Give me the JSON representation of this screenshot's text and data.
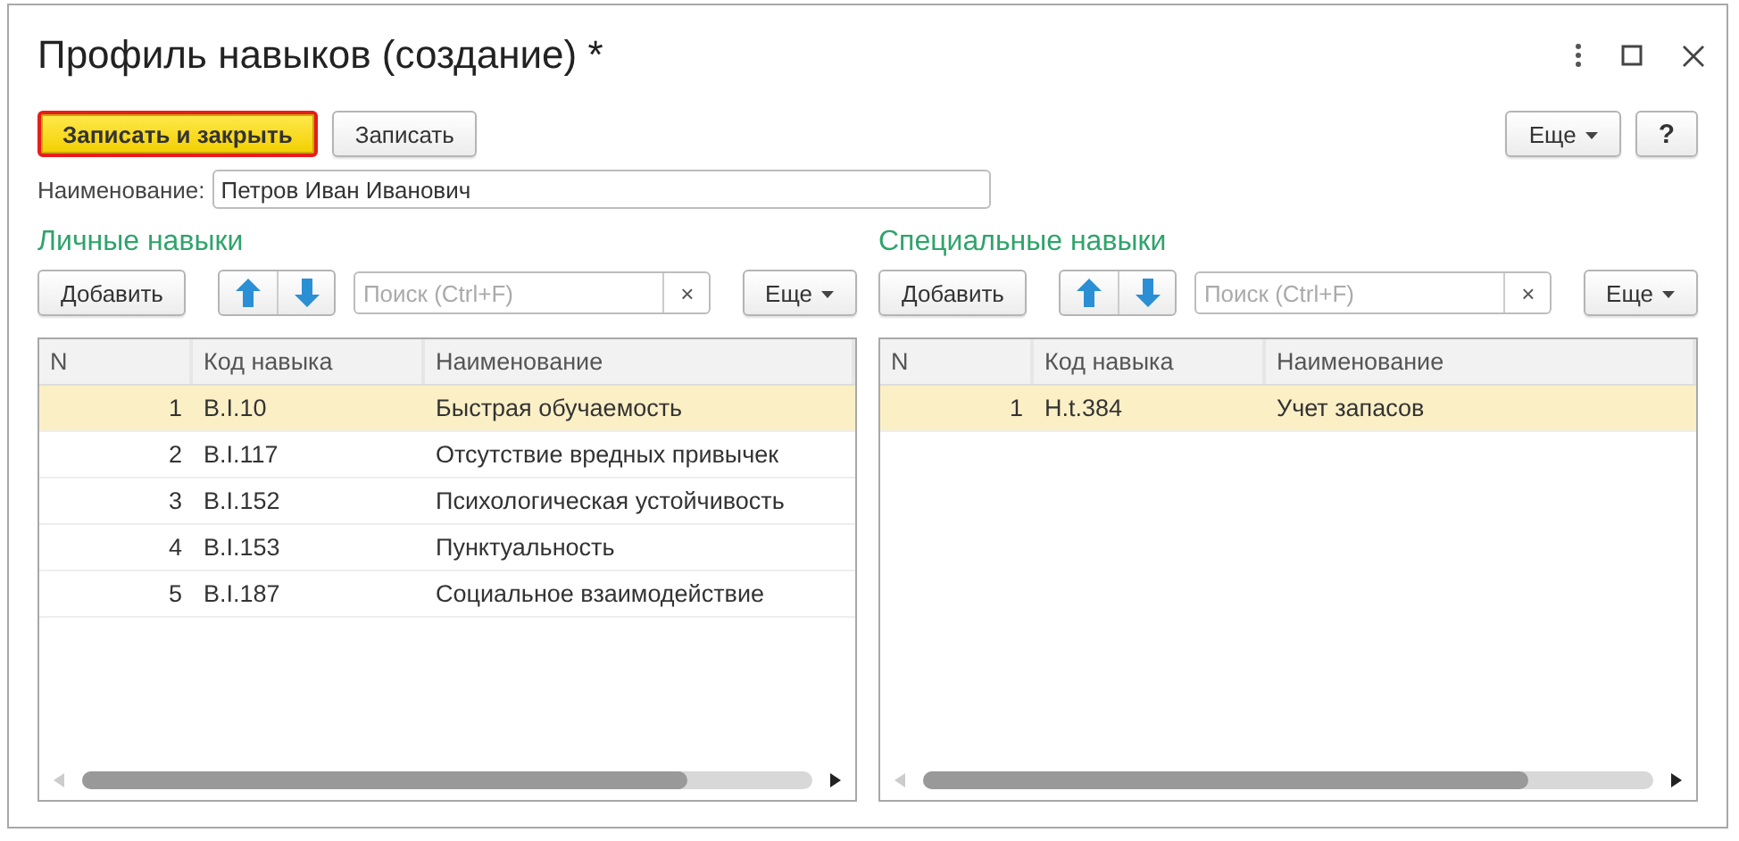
{
  "window": {
    "title": "Профиль навыков (создание) *"
  },
  "toolbar": {
    "buttons": [
      {
        "label": "Записать и закрыть",
        "kind": "primary"
      },
      {
        "label": "Записать",
        "kind": "normal"
      }
    ],
    "more": "Еще",
    "help": "?"
  },
  "name_field": {
    "label": "Наименование:",
    "value": "Петров Иван Иванович"
  },
  "panels": [
    {
      "title": "Личные навыки",
      "add": "Добавить",
      "search": {
        "placeholder": "Поиск (Ctrl+F)"
      },
      "clear": "×",
      "more": "Еще",
      "columns": [
        "N",
        "Код навыка",
        "Наименование"
      ],
      "rows": [
        {
          "cells": [
            "1",
            "B.I.10",
            "Быстрая обучаемость"
          ],
          "selected": true
        },
        {
          "cells": [
            "2",
            "B.I.117",
            "Отсутствие вредных привычек"
          ],
          "selected": false
        },
        {
          "cells": [
            "3",
            "B.I.152",
            "Психологическая устойчивость"
          ],
          "selected": false
        },
        {
          "cells": [
            "4",
            "B.I.153",
            "Пунктуальность"
          ],
          "selected": false
        },
        {
          "cells": [
            "5",
            "B.I.187",
            "Социальное взаимодействие"
          ],
          "selected": false
        }
      ]
    },
    {
      "title": "Специальные навыки",
      "add": "Добавить",
      "search": {
        "placeholder": "Поиск (Ctrl+F)"
      },
      "clear": "×",
      "more": "Еще",
      "columns": [
        "N",
        "Код навыка",
        "Наименование"
      ],
      "rows": [
        {
          "cells": [
            "1",
            "H.t.384",
            "Учет запасов"
          ],
          "selected": true
        }
      ]
    }
  ]
}
